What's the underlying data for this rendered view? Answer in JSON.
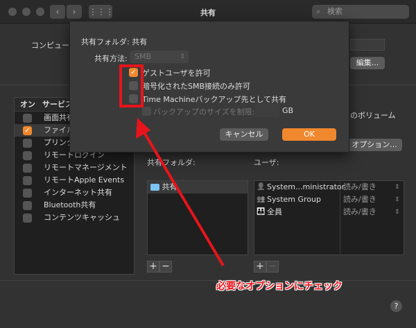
{
  "window": {
    "title": "共有",
    "search_placeholder": "検索"
  },
  "main": {
    "computer_label": "コンピュー",
    "edit_button": "編集...",
    "volume_text": "のボリューム",
    "options_button": "オプション...",
    "shared_folders_label": "共有フォルダ:",
    "users_label": "ユーザ:",
    "folders": [
      "共有"
    ],
    "users": [
      {
        "name": "System...ministrator",
        "perm": "読み/書き"
      },
      {
        "name": "System Group",
        "perm": "読み/書き"
      },
      {
        "name": "全員",
        "perm": "読み/書き"
      }
    ],
    "add": "+",
    "remove": "−",
    "help": "?"
  },
  "services": {
    "col_on": "オン",
    "col_service": "サービス",
    "items": [
      {
        "label": "画面共有",
        "on": false
      },
      {
        "label": "ファイル共有",
        "on": true
      },
      {
        "label": "プリンタ共有",
        "on": false
      },
      {
        "label": "リモートログイン",
        "on": false
      },
      {
        "label": "リモートマネージメント",
        "on": false
      },
      {
        "label": "リモートApple Events",
        "on": false
      },
      {
        "label": "インターネット共有",
        "on": false
      },
      {
        "label": "Bluetooth共有",
        "on": false
      },
      {
        "label": "コンテンツキャッシュ",
        "on": false
      }
    ]
  },
  "sheet": {
    "title": "共有フォルダ: 共有",
    "method_label": "共有方法:",
    "method_value": "SMB",
    "options": [
      {
        "label": "ゲストユーザを許可",
        "checked": true
      },
      {
        "label": "暗号化されたSMB接続のみ許可",
        "checked": false
      },
      {
        "label": "Time Machineバックアップ先として共有",
        "checked": false
      }
    ],
    "size_limit_label": "バックアップのサイズを制限:",
    "size_unit": "GB",
    "cancel": "キャンセル",
    "ok": "OK"
  },
  "annotation": {
    "text": "必要なオプションにチェック",
    "color": "#e8141b"
  }
}
